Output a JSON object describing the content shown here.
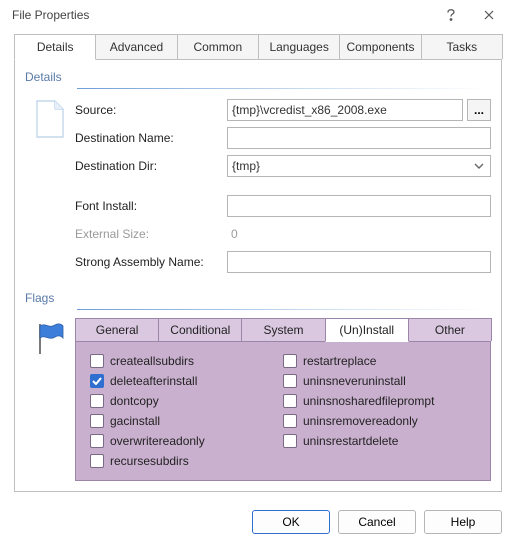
{
  "window": {
    "title": "File Properties"
  },
  "tabs": {
    "t0": "Details",
    "t1": "Advanced",
    "t2": "Common",
    "t3": "Languages",
    "t4": "Components",
    "t5": "Tasks"
  },
  "details": {
    "group_title": "Details",
    "labels": {
      "source": "Source:",
      "destname": "Destination Name:",
      "destdir": "Destination Dir:",
      "fontinstall": "Font Install:",
      "externalsize": "External Size:",
      "strongasm": "Strong Assembly Name:"
    },
    "values": {
      "source": "{tmp}\\vcredist_x86_2008.exe",
      "destname": "",
      "destdir": "{tmp}",
      "fontinstall": "",
      "externalsize": "0",
      "strongasm": ""
    },
    "browse": "..."
  },
  "flags": {
    "group_title": "Flags",
    "subtabs": {
      "general": "General",
      "conditional": "Conditional",
      "system": "System",
      "uninstall": "(Un)Install",
      "other": "Other"
    },
    "items": {
      "createallsubdirs": "createallsubdirs",
      "deleteafterinstall": "deleteafterinstall",
      "dontcopy": "dontcopy",
      "gacinstall": "gacinstall",
      "overwritereadonly": "overwritereadonly",
      "recursesubdirs": "recursesubdirs",
      "restartreplace": "restartreplace",
      "uninsneveruninstall": "uninsneveruninstall",
      "uninsnosharedfileprompt": "uninsnosharedfileprompt",
      "uninsremovereadonly": "uninsremovereadonly",
      "uninsrestartdelete": "uninsrestartdelete"
    },
    "checked": {
      "deleteafterinstall": true
    }
  },
  "buttons": {
    "ok": "OK",
    "cancel": "Cancel",
    "help": "Help"
  }
}
